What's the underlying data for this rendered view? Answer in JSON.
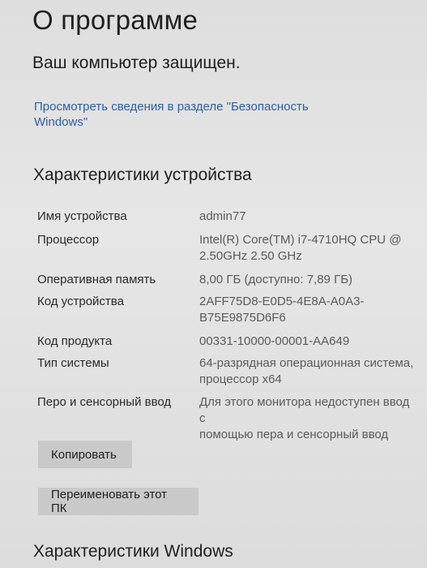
{
  "header": {
    "title": "О программе"
  },
  "protection": {
    "status": "Ваш компьютер защищен.",
    "link": "Просмотреть сведения в разделе \"Безопасность Windows\""
  },
  "device_specs": {
    "heading": "Характеристики устройства",
    "rows": [
      {
        "label": "Имя устройства",
        "value": "admin77"
      },
      {
        "label": "Процессор",
        "value": "Intel(R) Core(TM) i7-4710HQ CPU @\n2.50GHz   2.50 GHz"
      },
      {
        "label": "Оперативная память",
        "value": "8,00 ГБ (доступно: 7,89 ГБ)"
      },
      {
        "label": "Код устройства",
        "value": "2AFF75D8-E0D5-4E8A-A0A3-\nB75E9875D6F6"
      },
      {
        "label": "Код продукта",
        "value": "00331-10000-00001-AA649"
      },
      {
        "label": "Тип системы",
        "value": "64-разрядная операционная система,\nпроцессор x64"
      },
      {
        "label": "Перо и сенсорный ввод",
        "value": "Для этого монитора недоступен ввод с\nпомощью пера и сенсорный ввод"
      }
    ],
    "copy_button": "Копировать",
    "rename_button": "Переименовать этот ПК"
  },
  "windows_specs": {
    "heading": "Характеристики Windows"
  }
}
